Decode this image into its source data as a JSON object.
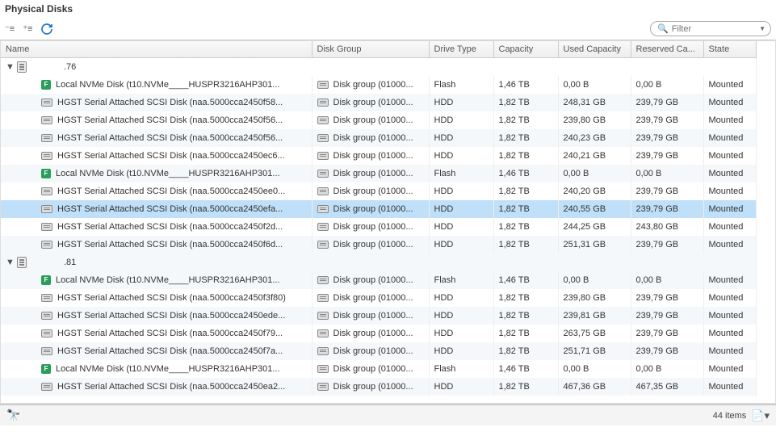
{
  "title": "Physical Disks",
  "filter_placeholder": "Filter",
  "columns": {
    "name": "Name",
    "diskGroup": "Disk Group",
    "driveType": "Drive Type",
    "capacity": "Capacity",
    "usedCapacity": "Used Capacity",
    "reservedCapacity": "Reserved Ca...",
    "state": "State"
  },
  "status": {
    "count_label": "44 items"
  },
  "groups": [
    {
      "host": ".76",
      "rows": [
        {
          "type": "flash",
          "name": "Local NVMe Disk (t10.NVMe____HUSPR3216AHP301...",
          "dg": "Disk group (01000...",
          "drive": "Flash",
          "cap": "1,46 TB",
          "used": "0,00 B",
          "res": "0,00 B",
          "state": "Mounted"
        },
        {
          "type": "hdd",
          "name": "HGST Serial Attached SCSI Disk (naa.5000cca2450f58...",
          "dg": "Disk group (01000...",
          "drive": "HDD",
          "cap": "1,82 TB",
          "used": "248,31 GB",
          "res": "239,79 GB",
          "state": "Mounted"
        },
        {
          "type": "hdd",
          "name": "HGST Serial Attached SCSI Disk (naa.5000cca2450f56...",
          "dg": "Disk group (01000...",
          "drive": "HDD",
          "cap": "1,82 TB",
          "used": "239,80 GB",
          "res": "239,79 GB",
          "state": "Mounted"
        },
        {
          "type": "hdd",
          "name": "HGST Serial Attached SCSI Disk (naa.5000cca2450f56...",
          "dg": "Disk group (01000...",
          "drive": "HDD",
          "cap": "1,82 TB",
          "used": "240,23 GB",
          "res": "239,79 GB",
          "state": "Mounted"
        },
        {
          "type": "hdd",
          "name": "HGST Serial Attached SCSI Disk (naa.5000cca2450ec6...",
          "dg": "Disk group (01000...",
          "drive": "HDD",
          "cap": "1,82 TB",
          "used": "240,21 GB",
          "res": "239,79 GB",
          "state": "Mounted"
        },
        {
          "type": "flash",
          "name": "Local NVMe Disk (t10.NVMe____HUSPR3216AHP301...",
          "dg": "Disk group (01000...",
          "drive": "Flash",
          "cap": "1,46 TB",
          "used": "0,00 B",
          "res": "0,00 B",
          "state": "Mounted"
        },
        {
          "type": "hdd",
          "name": "HGST Serial Attached SCSI Disk (naa.5000cca2450ee0...",
          "dg": "Disk group (01000...",
          "drive": "HDD",
          "cap": "1,82 TB",
          "used": "240,20 GB",
          "res": "239,79 GB",
          "state": "Mounted"
        },
        {
          "type": "hdd",
          "name": "HGST Serial Attached SCSI Disk (naa.5000cca2450efa...",
          "dg": "Disk group (01000...",
          "drive": "HDD",
          "cap": "1,82 TB",
          "used": "240,55 GB",
          "res": "239,79 GB",
          "state": "Mounted",
          "selected": true
        },
        {
          "type": "hdd",
          "name": "HGST Serial Attached SCSI Disk (naa.5000cca2450f2d...",
          "dg": "Disk group (01000...",
          "drive": "HDD",
          "cap": "1,82 TB",
          "used": "244,25 GB",
          "res": "243,80 GB",
          "state": "Mounted"
        },
        {
          "type": "hdd",
          "name": "HGST Serial Attached SCSI Disk (naa.5000cca2450f6d...",
          "dg": "Disk group (01000...",
          "drive": "HDD",
          "cap": "1,82 TB",
          "used": "251,31 GB",
          "res": "239,79 GB",
          "state": "Mounted"
        }
      ]
    },
    {
      "host": ".81",
      "rows": [
        {
          "type": "flash",
          "name": "Local NVMe Disk (t10.NVMe____HUSPR3216AHP301...",
          "dg": "Disk group (01000...",
          "drive": "Flash",
          "cap": "1,46 TB",
          "used": "0,00 B",
          "res": "0,00 B",
          "state": "Mounted"
        },
        {
          "type": "hdd",
          "name": "HGST Serial Attached SCSI Disk (naa.5000cca2450f3f80)",
          "dg": "Disk group (01000...",
          "drive": "HDD",
          "cap": "1,82 TB",
          "used": "239,80 GB",
          "res": "239,79 GB",
          "state": "Mounted"
        },
        {
          "type": "hdd",
          "name": "HGST Serial Attached SCSI Disk (naa.5000cca2450ede...",
          "dg": "Disk group (01000...",
          "drive": "HDD",
          "cap": "1,82 TB",
          "used": "239,81 GB",
          "res": "239,79 GB",
          "state": "Mounted"
        },
        {
          "type": "hdd",
          "name": "HGST Serial Attached SCSI Disk (naa.5000cca2450f79...",
          "dg": "Disk group (01000...",
          "drive": "HDD",
          "cap": "1,82 TB",
          "used": "263,75 GB",
          "res": "239,79 GB",
          "state": "Mounted"
        },
        {
          "type": "hdd",
          "name": "HGST Serial Attached SCSI Disk (naa.5000cca2450f7a...",
          "dg": "Disk group (01000...",
          "drive": "HDD",
          "cap": "1,82 TB",
          "used": "251,71 GB",
          "res": "239,79 GB",
          "state": "Mounted"
        },
        {
          "type": "flash",
          "name": "Local NVMe Disk (t10.NVMe____HUSPR3216AHP301...",
          "dg": "Disk group (01000...",
          "drive": "Flash",
          "cap": "1,46 TB",
          "used": "0,00 B",
          "res": "0,00 B",
          "state": "Mounted"
        },
        {
          "type": "hdd",
          "name": "HGST Serial Attached SCSI Disk (naa.5000cca2450ea2...",
          "dg": "Disk group (01000...",
          "drive": "HDD",
          "cap": "1,82 TB",
          "used": "467,36 GB",
          "res": "467,35 GB",
          "state": "Mounted"
        }
      ]
    }
  ]
}
